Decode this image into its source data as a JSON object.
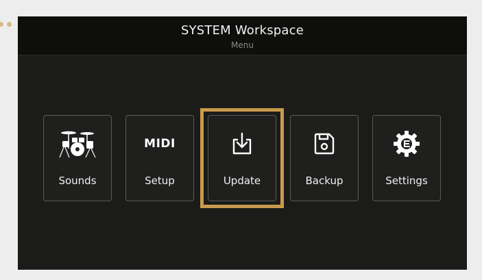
{
  "header": {
    "title": "SYSTEM Workspace",
    "subtitle": "Menu"
  },
  "menu": {
    "items": [
      {
        "label": "Sounds",
        "icon": "drum-kit-icon"
      },
      {
        "label": "Setup",
        "icon": "midi-icon",
        "icon_text": "MIDI"
      },
      {
        "label": "Update",
        "icon": "download-tray-icon",
        "selected": true
      },
      {
        "label": "Backup",
        "icon": "floppy-disk-icon"
      },
      {
        "label": "Settings",
        "icon": "gear-icon"
      }
    ]
  },
  "colors": {
    "background": "#1b1c1a",
    "header": "#0e0e0d",
    "tile_border": "#5a5b58",
    "selection": "#c89a4c",
    "text": "#f0f0f0"
  }
}
